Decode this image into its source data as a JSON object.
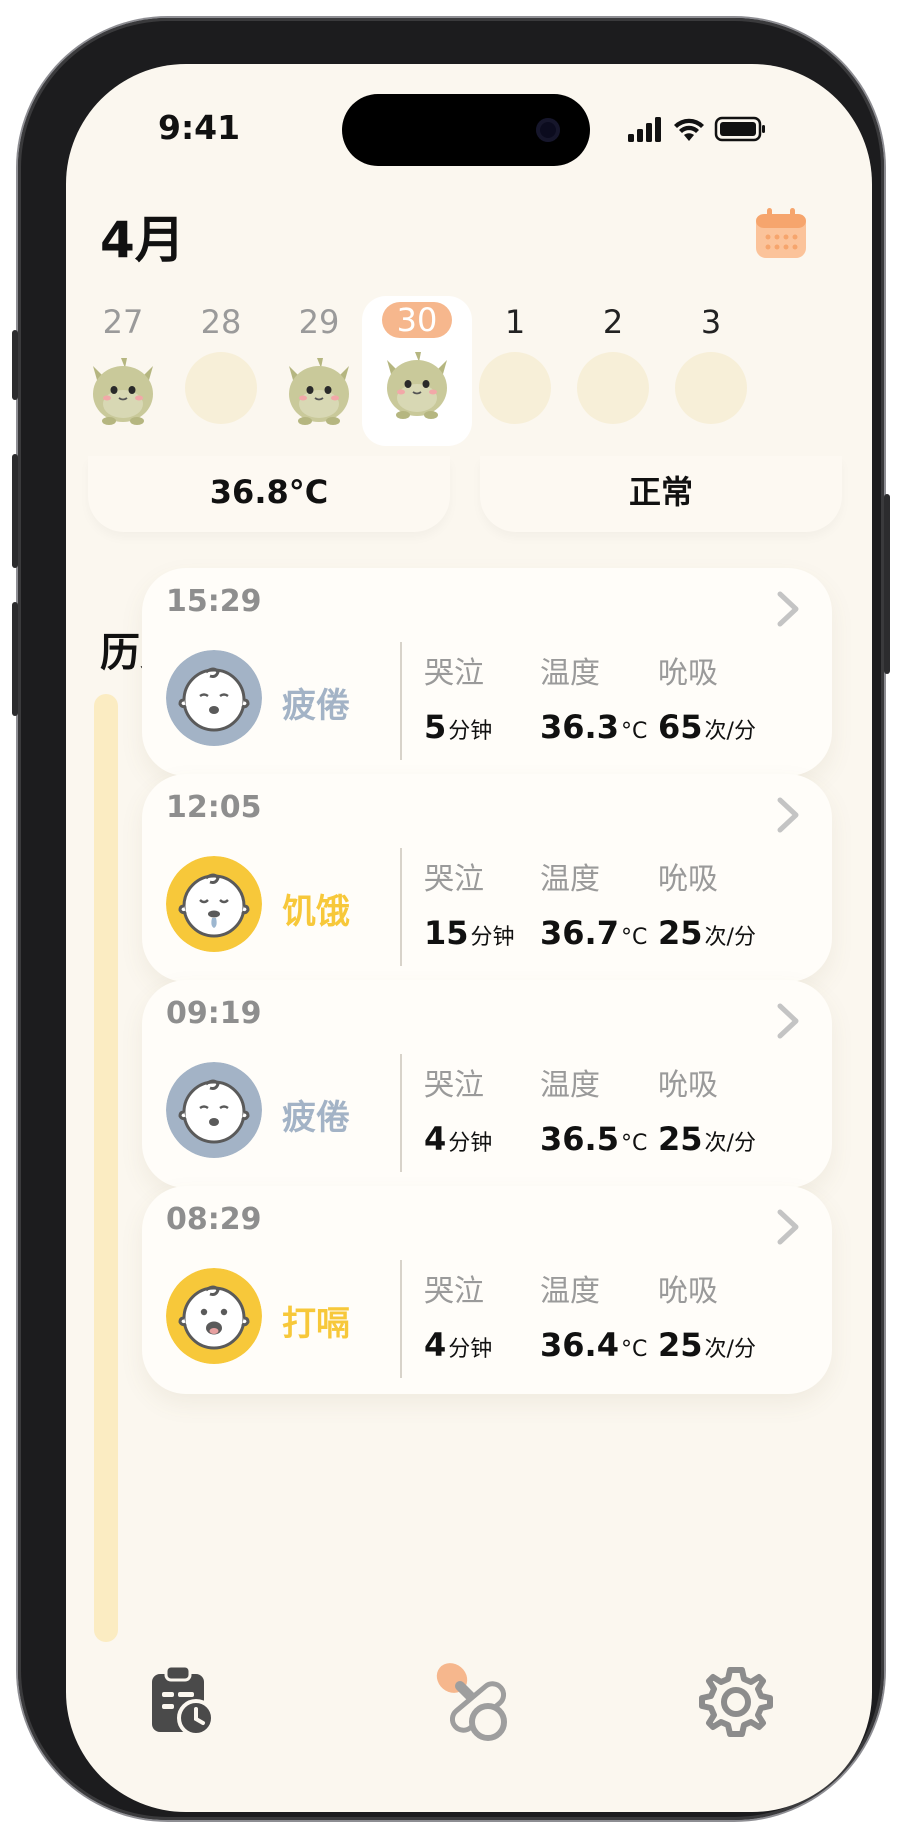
{
  "status_bar": {
    "time": "9:41"
  },
  "header": {
    "month": "4月"
  },
  "days": [
    {
      "num": "27",
      "has_monster": true,
      "selected": false,
      "future": false
    },
    {
      "num": "28",
      "has_monster": false,
      "selected": false,
      "future": false
    },
    {
      "num": "29",
      "has_monster": true,
      "selected": false,
      "future": false
    },
    {
      "num": "30",
      "has_monster": true,
      "selected": true,
      "future": false
    },
    {
      "num": "1",
      "has_monster": false,
      "selected": false,
      "future": true
    },
    {
      "num": "2",
      "has_monster": false,
      "selected": false,
      "future": true
    },
    {
      "num": "3",
      "has_monster": false,
      "selected": false,
      "future": true
    }
  ],
  "summary": {
    "temperature": "36.8°C",
    "status": "正常"
  },
  "history": {
    "title": "历史记录",
    "records": [
      {
        "time": "15:29",
        "mood": "疲倦",
        "mood_color": "#a3b3c6",
        "face": "tired",
        "cry_label": "哭泣",
        "cry_value": "5",
        "cry_unit": "分钟",
        "temp_label": "温度",
        "temp_value": "36.3",
        "temp_unit": "°C",
        "breath_label": "吮吸",
        "breath_value": "65",
        "breath_unit": "次/分"
      },
      {
        "time": "12:05",
        "mood": "饥饿",
        "mood_color": "#f7c83a",
        "face": "hungry",
        "cry_label": "哭泣",
        "cry_value": "15",
        "cry_unit": "分钟",
        "temp_label": "温度",
        "temp_value": "36.7",
        "temp_unit": "°C",
        "breath_label": "吮吸",
        "breath_value": "25",
        "breath_unit": "次/分"
      },
      {
        "time": "09:19",
        "mood": "疲倦",
        "mood_color": "#a3b3c6",
        "face": "tired",
        "cry_label": "哭泣",
        "cry_value": "4",
        "cry_unit": "分钟",
        "temp_label": "温度",
        "temp_value": "36.5",
        "temp_unit": "°C",
        "breath_label": "吮吸",
        "breath_value": "25",
        "breath_unit": "次/分"
      },
      {
        "time": "08:29",
        "mood": "打嗝",
        "mood_color": "#f7c83a",
        "face": "burp",
        "cry_label": "哭泣",
        "cry_value": "4",
        "cry_unit": "分钟",
        "temp_label": "温度",
        "temp_value": "36.4",
        "temp_unit": "°C",
        "breath_label": "吮吸",
        "breath_value": "25",
        "breath_unit": "次/分"
      }
    ]
  },
  "tabbar": {
    "icons": [
      "history-clipboard-icon",
      "pacifier-icon",
      "gear-icon"
    ]
  },
  "colors": {
    "background": "#fbf7ef",
    "accent": "#f6b78d",
    "tired": "#a3b3c6",
    "hungry": "#f7c83a",
    "timeline": "#fbecc2"
  }
}
